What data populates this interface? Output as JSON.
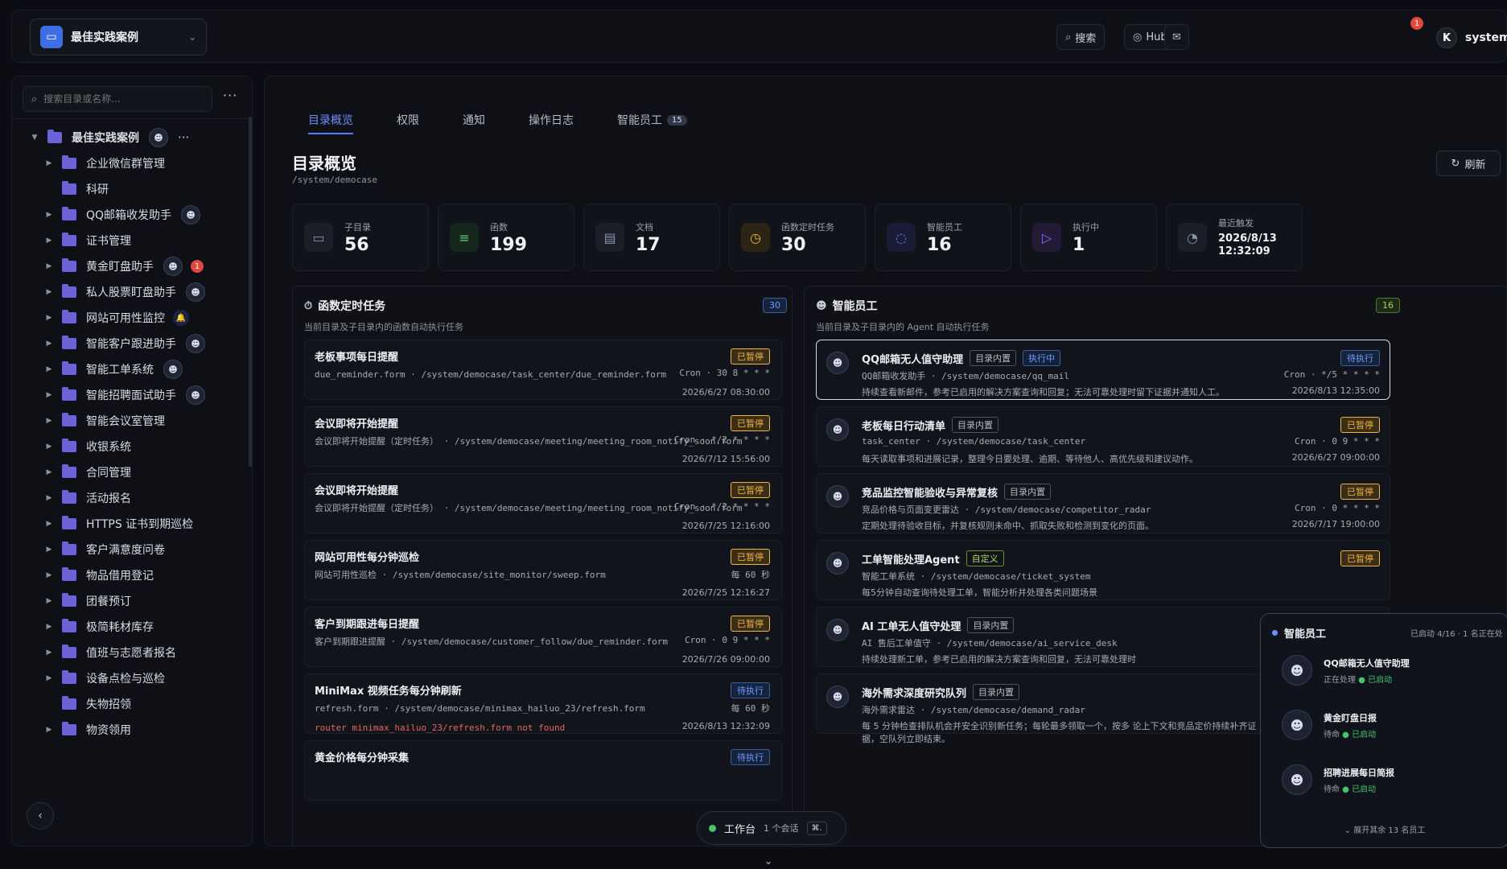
{
  "topbar": {
    "project": "最佳实践案例",
    "search_label": "搜索",
    "hub_label": "Hub",
    "mail_badge": "1",
    "user_name": "system",
    "user_initial": "K"
  },
  "sidebar": {
    "search_placeholder": "搜索目录或名称...",
    "root": "最佳实践案例",
    "items": [
      {
        "label": "企业微信群管理"
      },
      {
        "label": "科研"
      },
      {
        "label": "QQ邮箱收发助手"
      },
      {
        "label": "证书管理"
      },
      {
        "label": "黄金盯盘助手",
        "badge": "1"
      },
      {
        "label": "私人股票盯盘助手"
      },
      {
        "label": "网站可用性监控"
      },
      {
        "label": "智能客户跟进助手"
      },
      {
        "label": "智能工单系统"
      },
      {
        "label": "智能招聘面试助手"
      },
      {
        "label": "智能会议室管理"
      },
      {
        "label": "收银系统"
      },
      {
        "label": "合同管理"
      },
      {
        "label": "活动报名"
      },
      {
        "label": "HTTPS 证书到期巡检"
      },
      {
        "label": "客户满意度问卷"
      },
      {
        "label": "物品借用登记"
      },
      {
        "label": "团餐预订"
      },
      {
        "label": "极简耗材库存"
      },
      {
        "label": "值班与志愿者报名"
      },
      {
        "label": "设备点检与巡检"
      },
      {
        "label": "失物招领"
      },
      {
        "label": "物资领用"
      }
    ]
  },
  "tabs": [
    {
      "label": "目录概览"
    },
    {
      "label": "权限"
    },
    {
      "label": "通知"
    },
    {
      "label": "操作日志"
    },
    {
      "label": "智能员工",
      "count": "15"
    }
  ],
  "page": {
    "title": "目录概览",
    "path": "/system/democase",
    "refresh_label": "刷新"
  },
  "stats": [
    {
      "label": "子目录",
      "value": "56",
      "icon": "folder-icon",
      "color": "#8a93a6"
    },
    {
      "label": "函数",
      "value": "199",
      "icon": "sliders-icon",
      "color": "#5fd17a"
    },
    {
      "label": "文档",
      "value": "17",
      "icon": "document-icon",
      "color": "#8a93a6"
    },
    {
      "label": "函数定时任务",
      "value": "30",
      "icon": "timer-icon",
      "color": "#f0b34a"
    },
    {
      "label": "智能员工",
      "value": "16",
      "icon": "chat-icon",
      "color": "#6f7bff"
    },
    {
      "label": "执行中",
      "value": "1",
      "icon": "play-icon",
      "color": "#8a6bff"
    },
    {
      "label": "最近触发",
      "value_line1": "2026/8/13",
      "value_line2": "12:32:09",
      "icon": "clock-icon",
      "color": "#8a93a6"
    }
  ],
  "timers": {
    "title": "函数定时任务",
    "subtitle": "当前目录及子目录内的函数自动执行任务",
    "count": "30",
    "items": [
      {
        "title": "老板事项每日提醒",
        "desc": "due_reminder.form · /system/democase/task_center/due_reminder.form",
        "status": "已暂停",
        "kind": "paused",
        "cron": "Cron · 30 8 * * *",
        "time": "2026/6/27 08:30:00"
      },
      {
        "title": "会议即将开始提醒",
        "desc": "会议即将开始提醒（定时任务） · /system/democase/meeting/meeting_room_notify_soon.form",
        "status": "已暂停",
        "kind": "paused",
        "cron": "Cron · */2 * * * *",
        "time": "2026/7/12 15:56:00"
      },
      {
        "title": "会议即将开始提醒",
        "desc": "会议即将开始提醒（定时任务） · /system/democase/meeting/meeting_room_notify_soon.form",
        "status": "已暂停",
        "kind": "paused",
        "cron": "Cron · */2 * * * *",
        "time": "2026/7/25 12:16:00"
      },
      {
        "title": "网站可用性每分钟巡检",
        "desc": "网站可用性巡检 · /system/democase/site_monitor/sweep.form",
        "status": "已暂停",
        "kind": "paused",
        "cron": "每 60 秒",
        "time": "2026/7/25 12:16:27"
      },
      {
        "title": "客户到期跟进每日提醒",
        "desc": "客户到期跟进提醒 · /system/democase/customer_follow/due_reminder.form",
        "status": "已暂停",
        "kind": "paused",
        "cron": "Cron · 0 9 * * *",
        "time": "2026/7/26 09:00:00"
      },
      {
        "title": "MiniMax 视频任务每分钟刷新",
        "desc": "refresh.form · /system/democase/minimax_hailuo_23/refresh.form",
        "error": "router minimax_hailuo_23/refresh.form not found",
        "status": "待执行",
        "kind": "pending",
        "cron": "每 60 秒",
        "time": "2026/8/13 12:32:09"
      },
      {
        "title": "黄金价格每分钟采集",
        "desc": "",
        "status": "待执行",
        "kind": "pending",
        "cron": "",
        "time": ""
      }
    ]
  },
  "agents": {
    "title": "智能员工",
    "subtitle": "当前目录及子目录内的 Agent 自动执行任务",
    "count": "16",
    "items": [
      {
        "title": "QQ邮箱无人值守助理",
        "tag": "目录内置",
        "running_tag": "执行中",
        "path": "QQ邮箱收发助手 · /system/democase/qq_mail",
        "desc": "持续查看新邮件，参考已启用的解决方案查询和回复；无法可靠处理时留下证据并通知人工。",
        "status": "待执行",
        "kind": "pending",
        "cron": "Cron · */5 * * * *",
        "time": "2026/8/13 12:35:00"
      },
      {
        "title": "老板每日行动清单",
        "tag": "目录内置",
        "path": "task_center · /system/democase/task_center",
        "desc": "每天读取事项和进展记录，整理今日要处理、逾期、等待他人、高优先级和建议动作。",
        "status": "已暂停",
        "kind": "paused",
        "cron": "Cron · 0 9 * * *",
        "time": "2026/6/27 09:00:00"
      },
      {
        "title": "竞品监控智能验收与异常复核",
        "tag": "目录内置",
        "path": "竞品价格与页面变更雷达 · /system/democase/competitor_radar",
        "desc": "定期处理待验收目标，并复核规则未命中、抓取失败和检测到变化的页面。",
        "status": "已暂停",
        "kind": "paused",
        "cron": "Cron · 0 * * * *",
        "time": "2026/7/17 19:00:00"
      },
      {
        "title": "工单智能处理Agent",
        "tag": "自定义",
        "custom": true,
        "path": "智能工单系统 · /system/democase/ticket_system",
        "desc": "每5分钟自动查询待处理工单，智能分析并处理各类问题场景",
        "status": "已暂停",
        "kind": "paused",
        "cron": "",
        "time": ""
      },
      {
        "title": "AI 工单无人值守处理",
        "tag": "目录内置",
        "path": "AI 售后工单值守 · /system/democase/ai_service_desk",
        "desc": "持续处理新工单，参考已启用的解决方案查询和回复，无法可靠处理时",
        "status": "",
        "kind": "",
        "cron": "",
        "time": ""
      },
      {
        "title": "海外需求深度研究队列",
        "tag": "目录内置",
        "path": "海外需求雷达 · /system/democase/demand_radar",
        "desc": "每 5 分钟检查排队机会并安全识别新任务；每轮最多领取一个，按多 论上下文和竞品定价持续补齐证据，空队列立即结束。",
        "status": "",
        "kind": "",
        "cron": "",
        "time": ""
      }
    ]
  },
  "float_panel": {
    "title": "智能员工",
    "meta": "已启动 4/16 · 1 名正在处",
    "items": [
      {
        "name": "QQ邮箱无人值守助理",
        "state": "正在处理",
        "ok": "已启动"
      },
      {
        "name": "黄金盯盘日报",
        "state": "待命",
        "ok": "已启动"
      },
      {
        "name": "招聘进展每日简报",
        "state": "待命",
        "ok": "已启动"
      }
    ],
    "more": "展开其余 13 名员工"
  },
  "dock": {
    "label": "工作台",
    "sessions": "1 个会话",
    "shortcut": "⌘."
  }
}
